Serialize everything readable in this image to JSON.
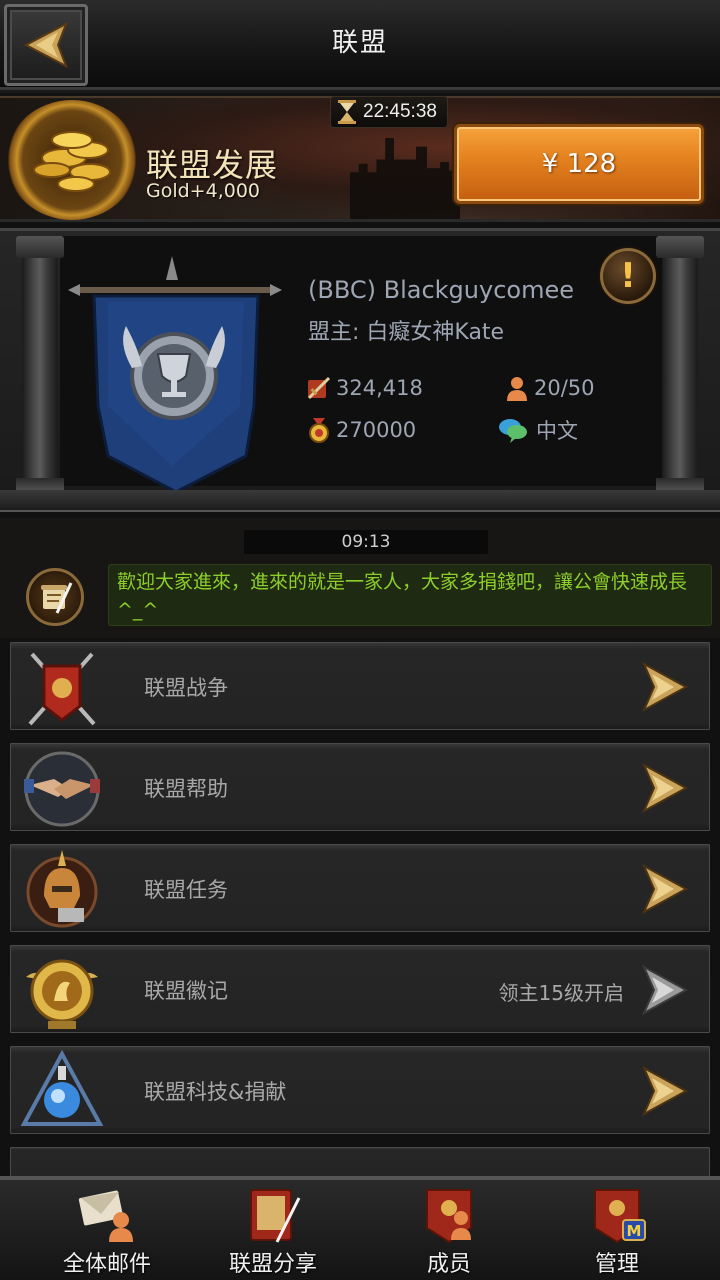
{
  "header": {
    "title": "联盟",
    "back_icon": "chevron-left-icon"
  },
  "development": {
    "title": "联盟发展",
    "subtitle": "Gold+4,000",
    "timer": "22:45:38",
    "price": "¥ 128",
    "icons": [
      "gold-coins-icon",
      "hourglass-icon"
    ]
  },
  "alliance": {
    "name": "(BBC) Blackguycomee",
    "leader": "盟主: 白癡女神Kate",
    "power": "324,418",
    "members": "20/50",
    "gift": "270000",
    "language": "中文"
  },
  "chat": {
    "time": "09:13",
    "message": "歡迎大家進來，進來的就是一家人，大家多捐錢吧，讓公會快速成長 ^_^"
  },
  "menu": [
    {
      "label": "联盟战争",
      "note": "",
      "icon": "war-banner-icon",
      "locked": false
    },
    {
      "label": "联盟帮助",
      "note": "",
      "icon": "handshake-icon",
      "locked": false
    },
    {
      "label": "联盟任务",
      "note": "",
      "icon": "quest-helmet-icon",
      "locked": false
    },
    {
      "label": "联盟徽记",
      "note": "领主15级开启",
      "icon": "emblem-icon",
      "locked": true
    },
    {
      "label": "联盟科技&捐献",
      "note": "",
      "icon": "tech-orb-icon",
      "locked": false
    }
  ],
  "nav": [
    {
      "label": "全体邮件",
      "icon": "mail-icon"
    },
    {
      "label": "联盟分享",
      "icon": "share-icon"
    },
    {
      "label": "成员",
      "icon": "members-icon"
    },
    {
      "label": "管理",
      "icon": "manage-icon"
    }
  ],
  "colors": {
    "accent_orange": "#e3801e",
    "chat_green": "#8dcf2a",
    "text_muted": "#9ea5b3",
    "flag_blue": "#1e3f7a"
  }
}
